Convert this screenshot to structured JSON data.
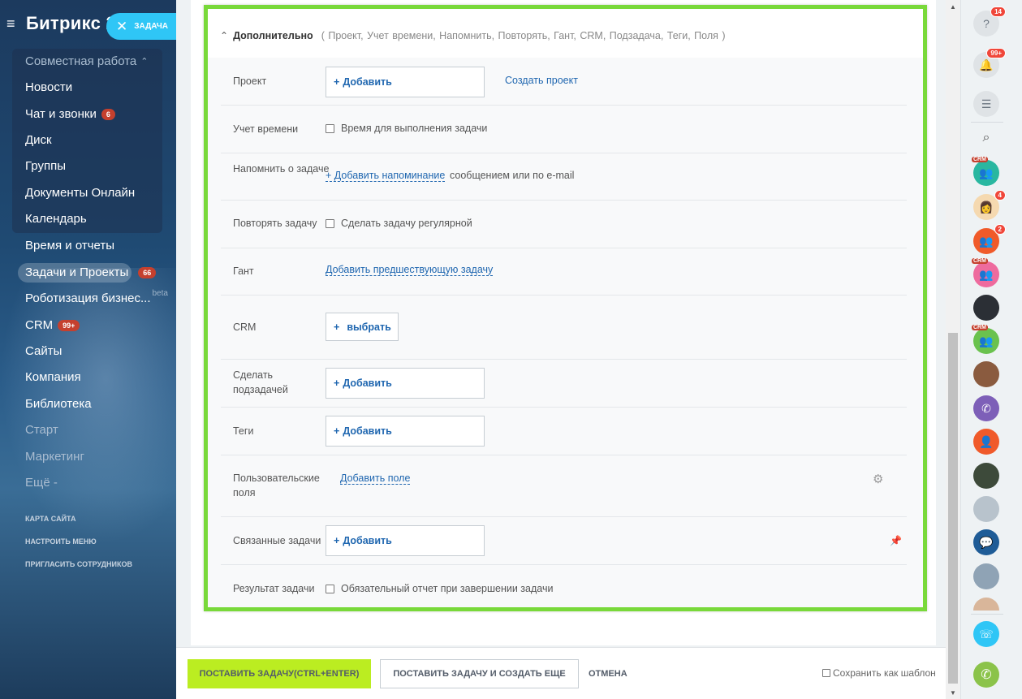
{
  "sidebar": {
    "brand": "Битрикс 2",
    "task_chip": "ЗАДАЧА",
    "group_title": "Совместная работа",
    "items": [
      {
        "label": "Новости"
      },
      {
        "label": "Чат и звонки",
        "count": "6"
      },
      {
        "label": "Диск"
      },
      {
        "label": "Группы"
      },
      {
        "label": "Документы Онлайн"
      },
      {
        "label": "Календарь"
      },
      {
        "label": "Время и отчеты"
      },
      {
        "label": "Задачи и Проекты",
        "count": "66"
      },
      {
        "label": "Роботизация бизнес...",
        "badge": "beta"
      },
      {
        "label": "CRM",
        "count": "99+"
      },
      {
        "label": "Сайты"
      },
      {
        "label": "Компания"
      },
      {
        "label": "Библиотека"
      },
      {
        "label": "Старт"
      },
      {
        "label": "Маркетинг"
      },
      {
        "label": "Ещё -"
      }
    ],
    "small_links": [
      "КАРТА САЙТА",
      "НАСТРОИТЬ МЕНЮ",
      "ПРИГЛАСИТЬ СОТРУДНИКОВ"
    ]
  },
  "form": {
    "header_title": "Дополнительно",
    "header_list": "( Проект,  Учет времени,  Напомнить,  Повторять,  Гант,  CRM,  Подзадача,  Теги,  Поля )",
    "project": {
      "label": "Проект",
      "add": "Добавить",
      "create_link": "Создать проект"
    },
    "time": {
      "label": "Учет времени",
      "checkbox": "Время для выполнения задачи"
    },
    "remind": {
      "label": "Напомнить о задаче",
      "link": "+ Добавить напоминание",
      "suffix": "сообщением или по e-mail"
    },
    "repeat": {
      "label": "Повторять задачу",
      "checkbox": "Сделать задачу регулярной"
    },
    "gantt": {
      "label": "Гант",
      "link": "Добавить предшествующую задачу"
    },
    "crm": {
      "label": "CRM",
      "button": "выбрать"
    },
    "subtask": {
      "label": "Сделать подзадачей",
      "add": "Добавить"
    },
    "tags": {
      "label": "Теги",
      "add": "Добавить"
    },
    "fields": {
      "label": "Пользовательские поля",
      "link": "Добавить поле"
    },
    "related": {
      "label": "Связанные задачи",
      "add": "Добавить"
    },
    "result": {
      "label": "Результат задачи",
      "checkbox": "Обязательный отчет при завершении задачи"
    }
  },
  "footer": {
    "submit": "ПОСТАВИТЬ ЗАДАЧУ(CTRL+ENTER)",
    "submit_more": "ПОСТАВИТЬ ЗАДАЧУ И СОЗДАТЬ ЕЩЕ",
    "cancel": "ОТМЕНА",
    "save_template": "Сохранить как шаблон"
  },
  "rightbar": {
    "help_badge": "14",
    "notify_badge": "99+",
    "crm_tag": "CRM",
    "avatar_badge_1": "4",
    "avatar_badge_2": "2"
  },
  "colors": {
    "accent_green": "#bbed21",
    "frame_green": "#79d93a",
    "link_blue": "#2067b0",
    "chip_blue": "#2fc6f6"
  }
}
